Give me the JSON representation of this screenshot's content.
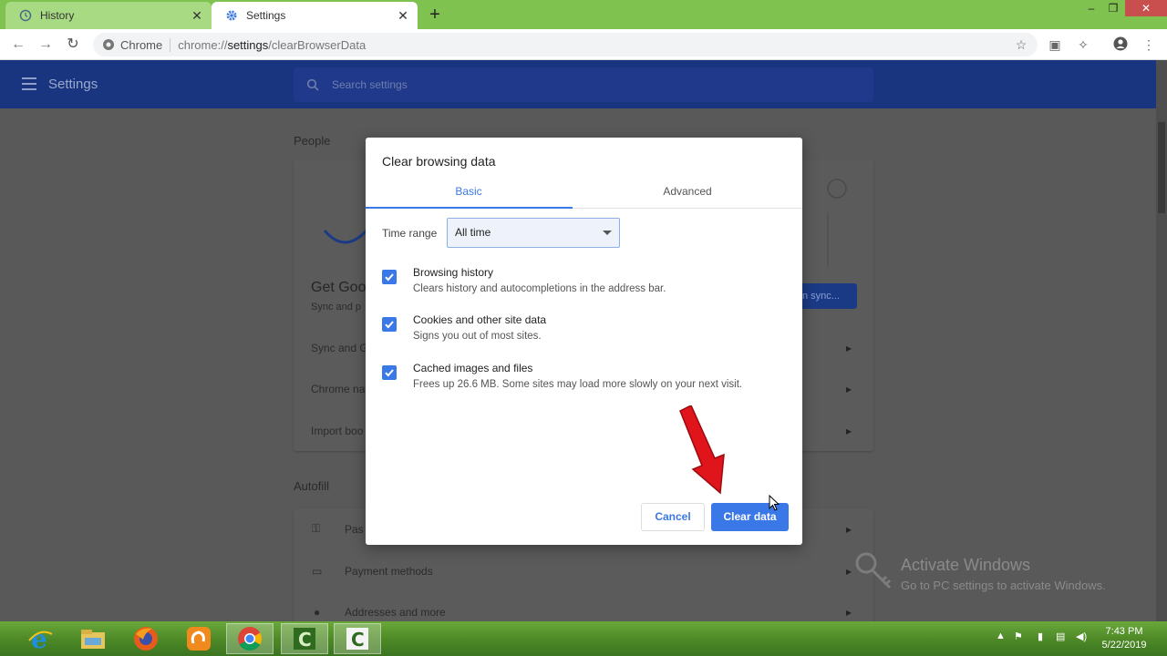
{
  "browser": {
    "tabs": [
      {
        "label": "History",
        "icon": "history-icon",
        "active": false
      },
      {
        "label": "Settings",
        "icon": "gear-icon",
        "active": true
      }
    ],
    "omnibox": {
      "site_label": "Chrome",
      "url_prefix": "chrome://",
      "url_host": "settings",
      "url_path": "/clearBrowserData"
    },
    "colors": {
      "tabstrip": "#7fc24f",
      "accent": "#3b78e7"
    }
  },
  "settings": {
    "header_title": "Settings",
    "search_placeholder": "Search settings",
    "sections": {
      "people_label": "People",
      "get_google_partial": "Get Goo",
      "sync_and_partial": "Sync and p",
      "sync_and_g_partial": "Sync and G",
      "chrome_name_partial": "Chrome na",
      "import_partial": "Import boo",
      "sync_button_partial": "n sync...",
      "autofill_label": "Autofill",
      "passwords_partial": "Pas",
      "payment_methods": "Payment methods",
      "addresses": "Addresses and more"
    }
  },
  "dialog": {
    "title": "Clear browsing data",
    "tabs": {
      "basic": "Basic",
      "advanced": "Advanced"
    },
    "time_range": {
      "label": "Time range",
      "value": "All time"
    },
    "items": [
      {
        "title": "Browsing history",
        "desc": "Clears history and autocompletions in the address bar.",
        "checked": true
      },
      {
        "title": "Cookies and other site data",
        "desc": "Signs you out of most sites.",
        "checked": true
      },
      {
        "title": "Cached images and files",
        "desc": "Frees up 26.6 MB. Some sites may load more slowly on your next visit.",
        "checked": true
      }
    ],
    "buttons": {
      "cancel": "Cancel",
      "clear": "Clear data"
    }
  },
  "watermark": {
    "line1": "Activate Windows",
    "line2": "Go to PC settings to activate Windows."
  },
  "taskbar": {
    "apps": [
      "internet-explorer-icon",
      "file-explorer-icon",
      "firefox-icon",
      "uc-browser-icon",
      "chrome-icon",
      "camtasia-icon",
      "camtasia-recorder-icon"
    ],
    "clock_time": "7:43 PM",
    "clock_date": "5/22/2019"
  }
}
